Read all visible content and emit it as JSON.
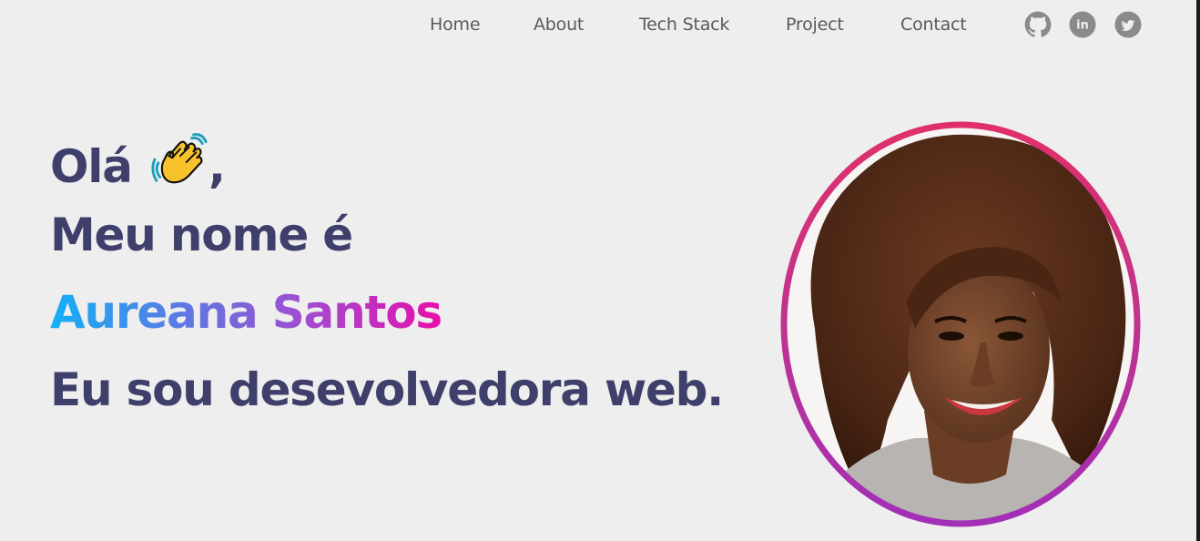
{
  "nav": {
    "items": [
      {
        "label": "Home"
      },
      {
        "label": "About"
      },
      {
        "label": "Tech Stack"
      },
      {
        "label": "Project"
      },
      {
        "label": "Contact"
      }
    ],
    "social": [
      {
        "icon": "github-icon"
      },
      {
        "icon": "linkedin-icon",
        "text": "in"
      },
      {
        "icon": "twitter-icon"
      }
    ]
  },
  "hero": {
    "greeting": "Olá",
    "greeting_suffix": ",",
    "wave_icon": "waving-hand-icon",
    "intro": "Meu nome é",
    "name": "Aureana Santos",
    "role": "Eu sou desevolvedora web."
  },
  "colors": {
    "heading": "#3f3f6b",
    "nav_text": "#5a5a5a",
    "background": "#eeeeee",
    "social_icon": "#8a8a8a",
    "name_gradient": [
      "#13b0f5",
      "#5f77e1",
      "#a14cd0",
      "#e70faa"
    ],
    "portrait_ring": [
      "#e0306a",
      "#c0338f",
      "#a22fb8"
    ]
  }
}
